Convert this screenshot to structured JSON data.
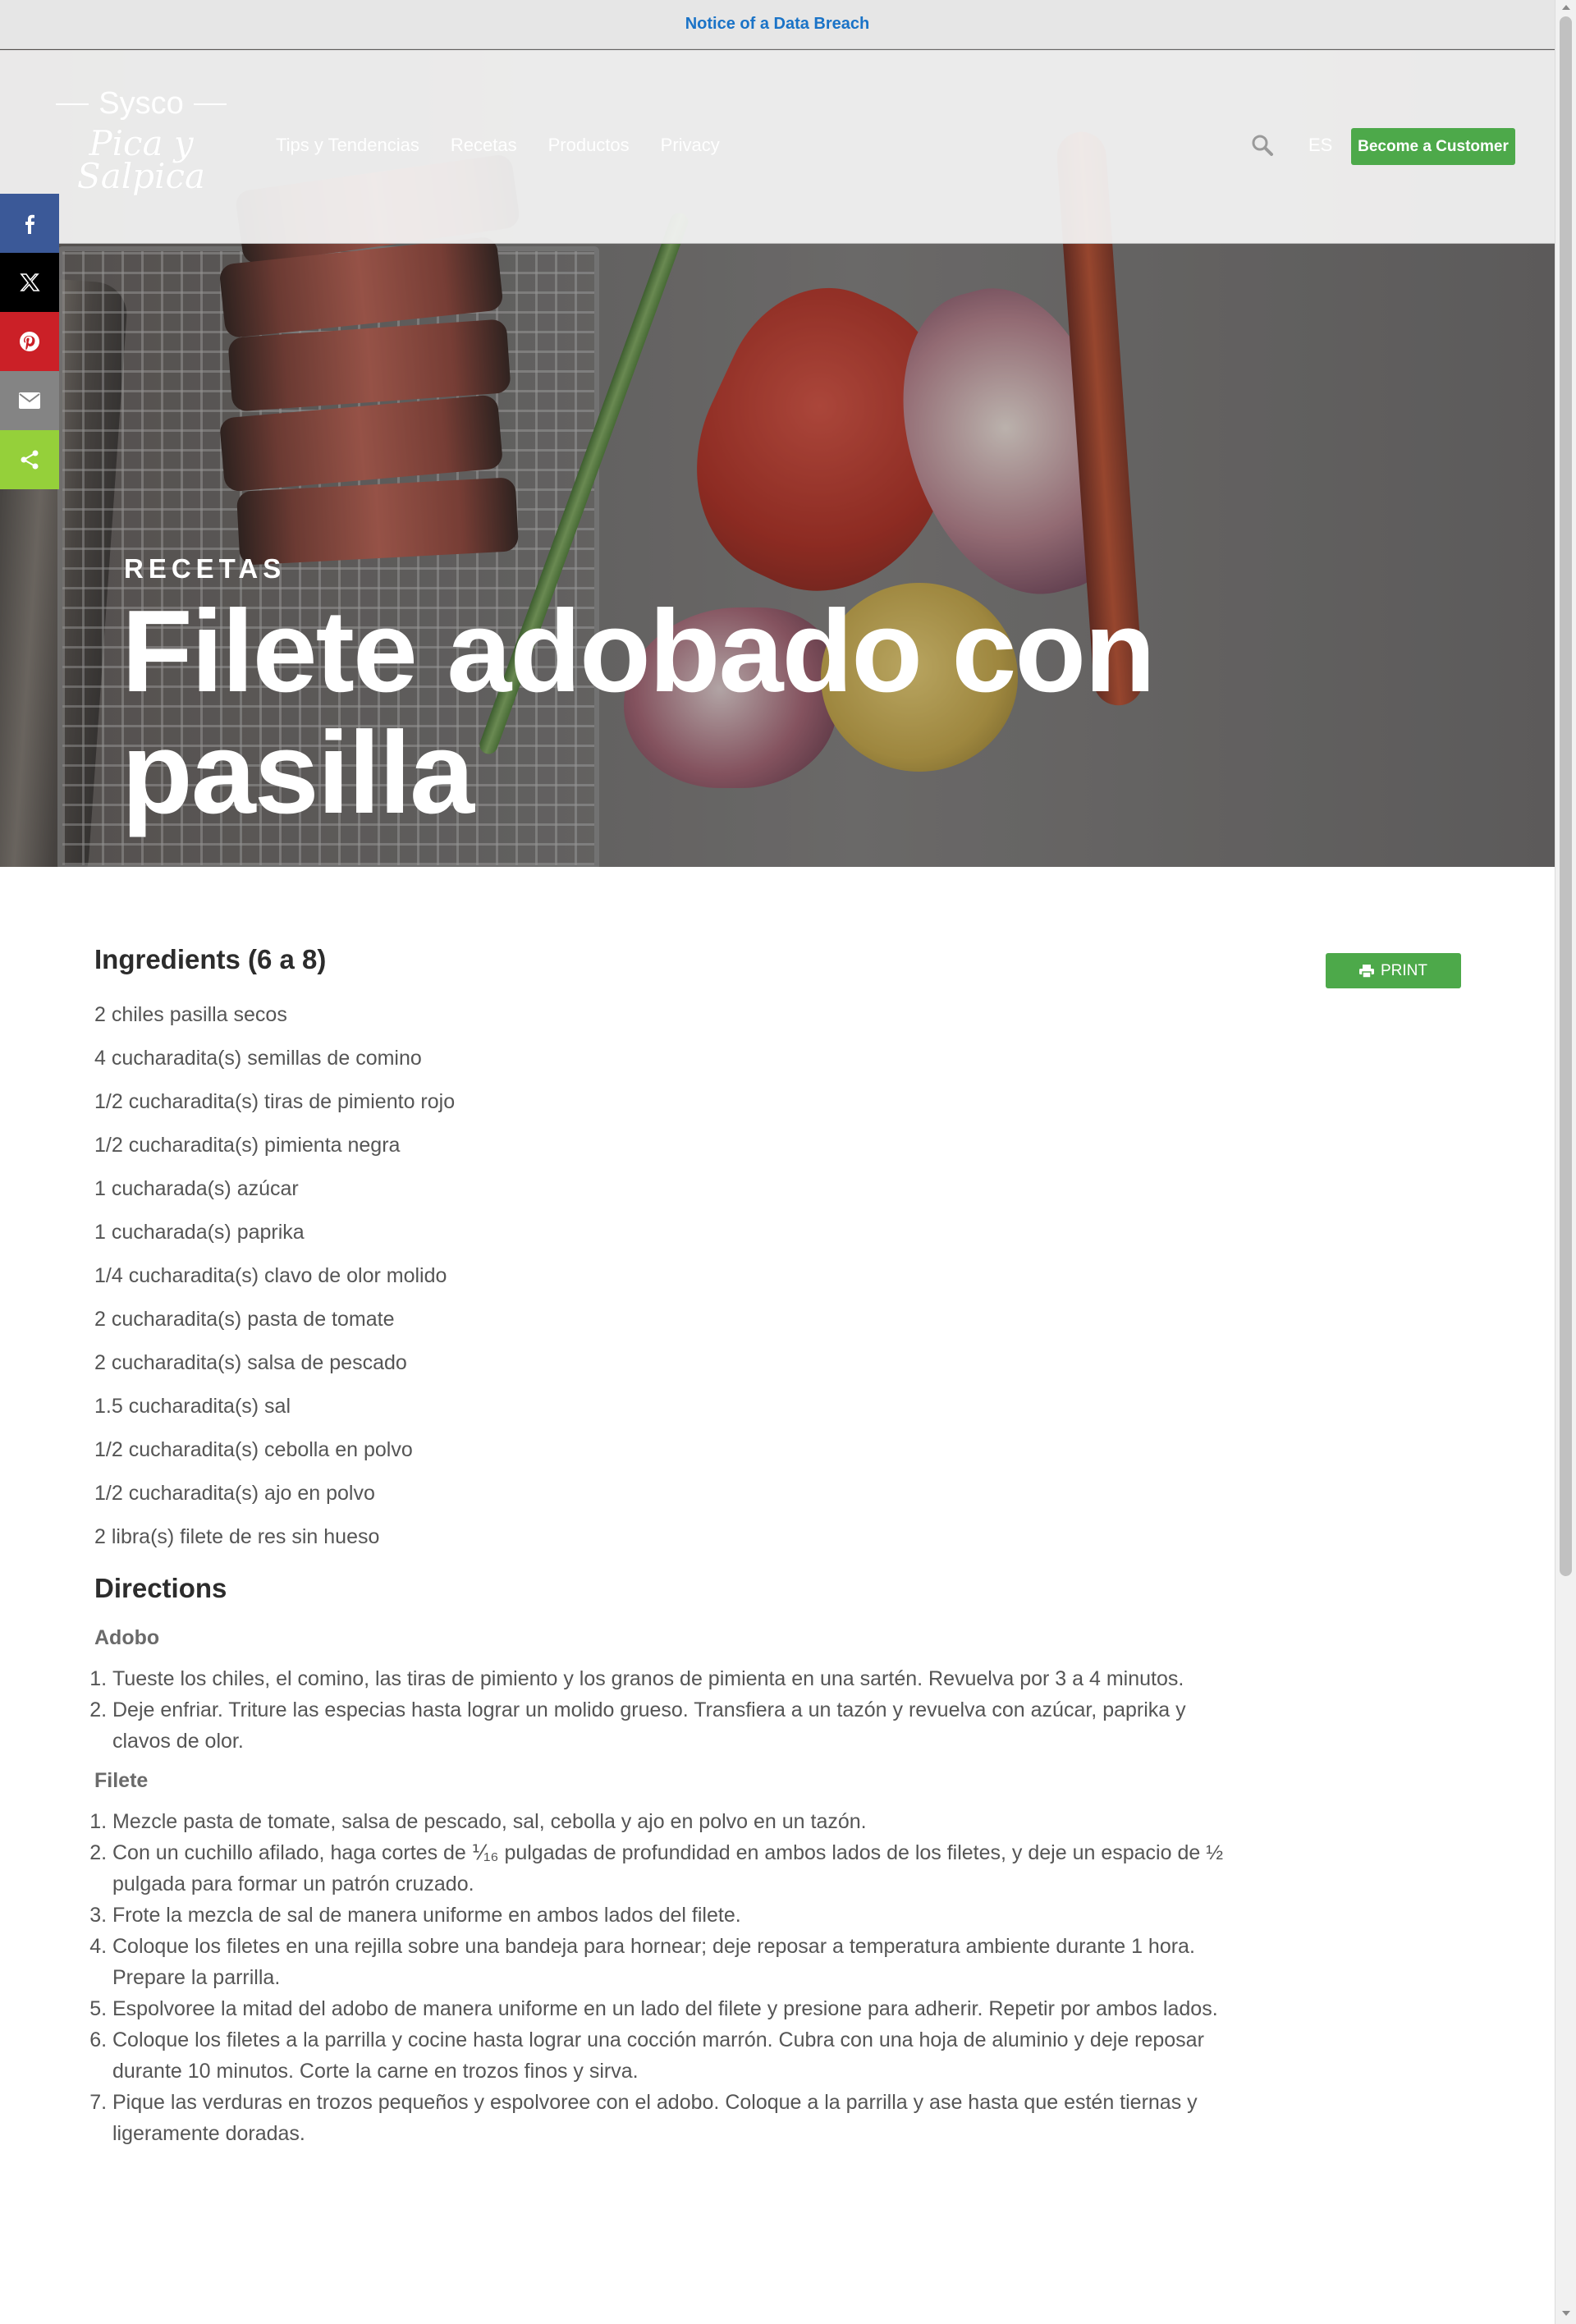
{
  "notice": {
    "label": "Notice of a Data Breach"
  },
  "header": {
    "logo_top": "Sysco",
    "logo_script_line1": "Pica y",
    "logo_script_line2": "Salpica",
    "nav": [
      {
        "label": "Tips y Tendencias"
      },
      {
        "label": "Recetas"
      },
      {
        "label": "Productos"
      },
      {
        "label": "Privacy"
      }
    ],
    "search_icon": "search-icon",
    "language": "ES",
    "cta_label": "Become a Customer"
  },
  "social": [
    {
      "name": "facebook",
      "icon": "facebook-icon",
      "color": "#3b5998"
    },
    {
      "name": "x",
      "icon": "x-icon",
      "color": "#000000"
    },
    {
      "name": "pinterest",
      "icon": "pinterest-icon",
      "color": "#cb2027"
    },
    {
      "name": "email",
      "icon": "email-icon",
      "color": "#848484"
    },
    {
      "name": "share",
      "icon": "share-icon",
      "color": "#95d03a"
    }
  ],
  "hero": {
    "kicker": "RECETAS",
    "title": "Filete adobado con pasilla"
  },
  "recipe": {
    "ingredients_title": "Ingredients (6 a 8)",
    "print_label": "PRINT",
    "ingredients": [
      "2 chiles pasilla secos",
      "4 cucharadita(s) semillas de comino",
      "1/2 cucharadita(s) tiras de pimiento rojo",
      "1/2 cucharadita(s) pimienta negra",
      "1 cucharada(s) azúcar",
      "1 cucharada(s) paprika",
      "1/4 cucharadita(s) clavo de olor molido",
      "2 cucharadita(s) pasta de tomate",
      "2 cucharadita(s) salsa de pescado",
      "1.5 cucharadita(s) sal",
      "1/2 cucharadita(s) cebolla en polvo",
      "1/2 cucharadita(s) ajo en polvo",
      "2 libra(s) filete de res sin hueso"
    ],
    "directions_title": "Directions",
    "sections": [
      {
        "title": "Adobo",
        "steps": [
          "Tueste los chiles, el comino, las tiras de pimiento y los granos de pimienta en una sartén. Revuelva por 3 a 4 minutos.",
          "Deje enfriar. Triture las especias hasta lograr un molido grueso. Transfiera a un tazón y revuelva con azúcar, paprika y clavos de olor."
        ]
      },
      {
        "title": "Filete",
        "steps": [
          "Mezcle pasta de tomate, salsa de pescado, sal, cebolla y ajo en polvo en un tazón.",
          "Con un cuchillo afilado, haga cortes de ⅟₁₆ pulgadas de profundidad en ambos lados de los filetes, y deje un espacio de ½ pulgada para formar un patrón cruzado.",
          "Frote la mezcla de sal de manera uniforme en ambos lados del filete.",
          "Coloque los filetes en una rejilla sobre una bandeja para hornear; deje reposar a temperatura ambiente durante 1 hora. Prepare la parrilla.",
          "Espolvoree la mitad del adobo de manera uniforme en un lado del filete y presione para adherir. Repetir por ambos lados.",
          "Coloque los filetes a la parrilla y cocine hasta lograr una cocción marrón. Cubra con una hoja de aluminio y deje reposar durante 10 minutos. Corte la carne en trozos finos y sirva.",
          "Pique las verduras en trozos pequeños y espolvoree con el adobo. Coloque a la parrilla y ase hasta que estén tiernas y ligeramente doradas."
        ]
      }
    ]
  }
}
